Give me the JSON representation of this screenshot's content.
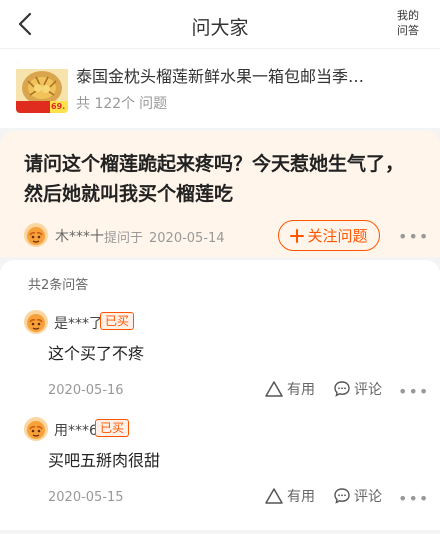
{
  "header": {
    "title": "问大家",
    "my_questions_line1": "我的",
    "my_questions_line2": "问答"
  },
  "product": {
    "title": "泰国金枕头榴莲新鲜水果一箱包邮当季…",
    "count_prefix": "共 122个",
    "count_suffix": "问题",
    "thumb_badge": "69."
  },
  "question": {
    "text": "请问这个榴莲跪起来疼吗？今天惹她生气了，然后她就叫我买个榴莲吃",
    "asker": "木***十",
    "asked_label": "提问于",
    "date": "2020-05-14",
    "follow_label": "关注问题"
  },
  "answers": {
    "header": "共2条问答",
    "items": [
      {
        "user": "是***了",
        "badge": "已买",
        "content": "这个买了不疼",
        "date": "2020-05-16",
        "useful_label": "有用",
        "comment_label": "评论"
      },
      {
        "user": "用***6",
        "badge": "已买",
        "content": "买吧五掰肉很甜",
        "date": "2020-05-15",
        "useful_label": "有用",
        "comment_label": "评论"
      }
    ]
  },
  "icons": {
    "back": "chevron-left-icon",
    "more": "more-dots-icon",
    "thumb_up": "thumb-up-icon",
    "comment": "comment-bubble-icon",
    "plus": "plus-icon"
  },
  "colors": {
    "accent": "#ff5500",
    "question_bg": "#fff5ea",
    "page_bg": "#f4f4f4",
    "avatar": "#f7a13a"
  }
}
